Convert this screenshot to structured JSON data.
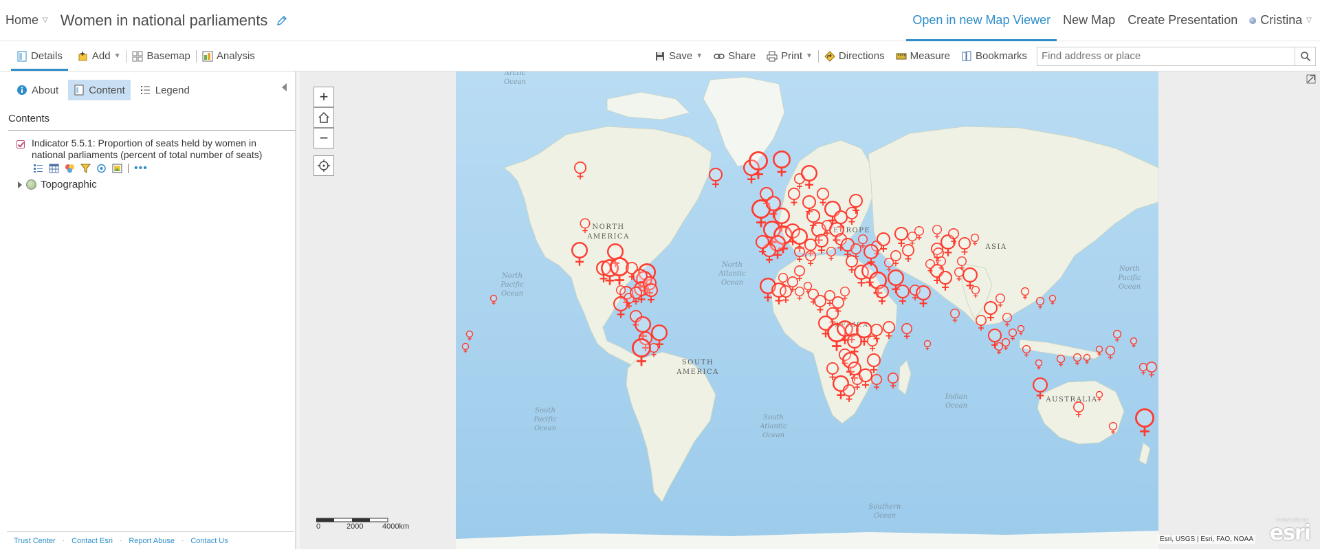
{
  "header": {
    "home": "Home",
    "title": "Women in national parliaments",
    "links": {
      "open_viewer": "Open in new Map Viewer",
      "new_map": "New Map",
      "create_presentation": "Create Presentation"
    },
    "user": "Cristina"
  },
  "toolbar": {
    "details": "Details",
    "add": "Add",
    "basemap": "Basemap",
    "analysis": "Analysis",
    "save": "Save",
    "share": "Share",
    "print": "Print",
    "directions": "Directions",
    "measure": "Measure",
    "bookmarks": "Bookmarks",
    "search_placeholder": "Find address or place"
  },
  "panel": {
    "tabs": {
      "about": "About",
      "content": "Content",
      "legend": "Legend"
    },
    "contents_heading": "Contents",
    "layer_name": "Indicator 5.5.1: Proportion of seats held by women in national parliaments (percent of total number of seats)",
    "basemap_layer": "Topographic",
    "footer": [
      "Trust Center",
      "Contact Esri",
      "Report Abuse",
      "Contact Us"
    ]
  },
  "map": {
    "labels": {
      "arctic": [
        "Arctic",
        "Ocean"
      ],
      "north_america": [
        "NORTH",
        "AMERICA"
      ],
      "north_pacific": [
        "North",
        "Pacific",
        "Ocean"
      ],
      "north_pacific_east": [
        "North",
        "Pacific",
        "Ocean"
      ],
      "north_atlantic": [
        "North",
        "Atlantic",
        "Ocean"
      ],
      "south_pacific": [
        "South",
        "Pacific",
        "Ocean"
      ],
      "south_atlantic": [
        "South",
        "Atlantic",
        "Ocean"
      ],
      "south_america": [
        "SOUTH",
        "AMERICA"
      ],
      "europe": "EUROPE",
      "africa": "AFRICA",
      "asia": "ASIA",
      "indian": [
        "Indian",
        "Ocean"
      ],
      "australia": "AUSTRALIA",
      "southern": [
        "Southern",
        "Ocean"
      ]
    },
    "scale_labels": [
      "0",
      "2000",
      "4000km"
    ],
    "attribution": "Esri, USGS | Esri, FAO, NOAA",
    "powered_by": "POWERED BY",
    "logo": "esri",
    "colors": {
      "ocean": "#a9d3ef",
      "land": "#eef1e3",
      "ice": "#ffffff",
      "symbol": "#ff3b2f"
    }
  }
}
